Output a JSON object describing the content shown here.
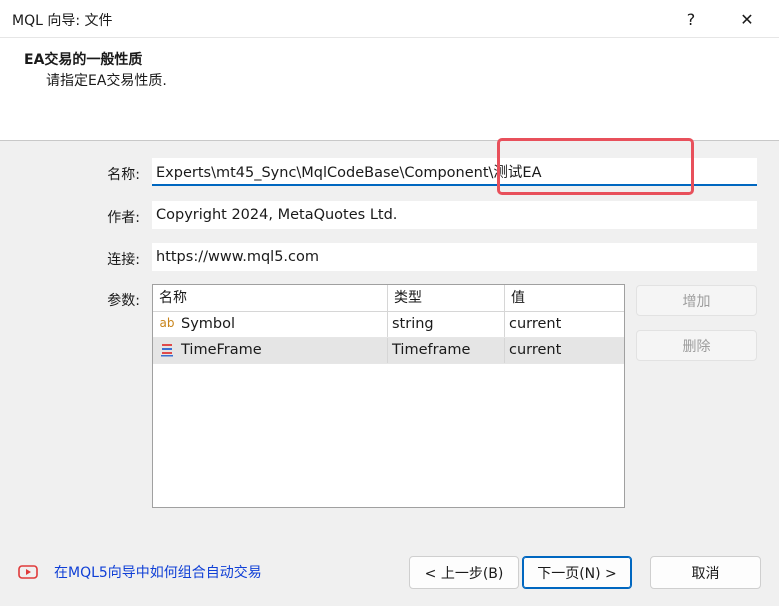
{
  "window": {
    "title": "MQL 向导: 文件",
    "help": "?",
    "close": "✕"
  },
  "header": {
    "title": "EA交易的一般性质",
    "subtitle": "请指定EA交易性质."
  },
  "form": {
    "name_label": "名称:",
    "name_value": "Experts\\mt45_Sync\\MqlCodeBase\\Component\\测试EA",
    "author_label": "作者:",
    "author_value": "Copyright 2024, MetaQuotes Ltd.",
    "link_label": "连接:",
    "link_value": "https://www.mql5.com",
    "params_label": "参数:"
  },
  "params": {
    "columns": [
      "名称",
      "类型",
      "值"
    ],
    "rows": [
      {
        "name": "Symbol",
        "type": "string",
        "value": "current",
        "icon": "ab-string-icon"
      },
      {
        "name": "TimeFrame",
        "type": "Timeframe",
        "value": "current",
        "icon": "enum-list-icon"
      }
    ],
    "add_label": "增加",
    "delete_label": "删除"
  },
  "footer": {
    "link_text": "在MQL5向导中如何组合自动交易",
    "link_icon": "video-icon",
    "prev_label": "< 上一步(B)",
    "next_label": "下一页(N) >",
    "cancel_label": "取消"
  },
  "colors": {
    "accent": "#0067c0",
    "highlight": "#e8505b",
    "link": "#0f3fd6",
    "video": "#e03a3a"
  }
}
